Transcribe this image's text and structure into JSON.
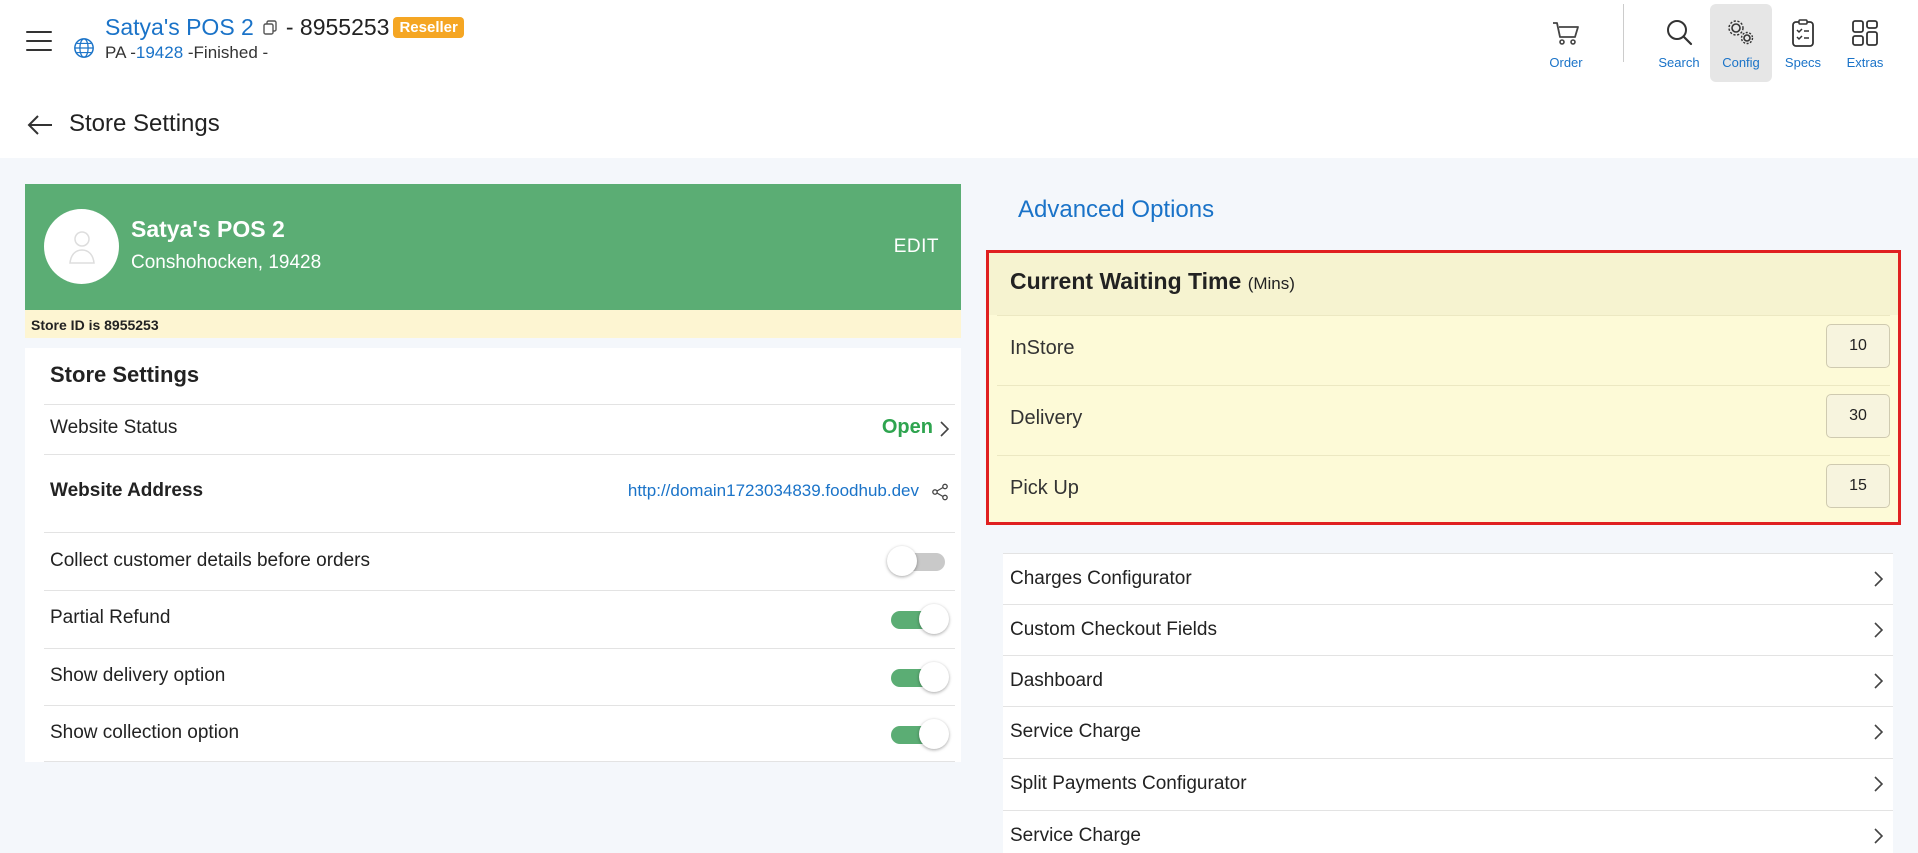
{
  "header": {
    "store_name": "Satya's POS 2",
    "store_id_text": "- 8955253",
    "badge": "Reseller",
    "line2_prefix": "PA -",
    "line2_zip": "19428",
    "line2_suffix": " -Finished -",
    "nav": [
      {
        "label": "Order",
        "icon": "cart-icon"
      },
      {
        "label": "Search",
        "icon": "search-icon"
      },
      {
        "label": "Config",
        "icon": "gears-icon"
      },
      {
        "label": "Specs",
        "icon": "clipboard-icon"
      },
      {
        "label": "Extras",
        "icon": "grid-icon"
      }
    ]
  },
  "subheader": {
    "title": "Store Settings"
  },
  "store_card": {
    "name": "Satya's POS 2",
    "address": "Conshohocken, 19428",
    "edit_label": "EDIT",
    "store_id_note": "Store ID is 8955253"
  },
  "settings": {
    "title": "Store Settings",
    "website_status_label": "Website Status",
    "website_status_value": "Open",
    "website_address_label": "Website Address",
    "website_address_value": "http://domain1723034839.foodhub.dev",
    "toggles": [
      {
        "label": "Collect customer details before orders",
        "on": false
      },
      {
        "label": "Partial Refund",
        "on": true
      },
      {
        "label": "Show delivery option",
        "on": true
      },
      {
        "label": "Show collection option",
        "on": true
      }
    ]
  },
  "advanced": {
    "title": "Advanced Options",
    "waiting_title": "Current Waiting Time",
    "waiting_unit": "(Mins)",
    "waiting_rows": [
      {
        "label": "InStore",
        "value": "10"
      },
      {
        "label": "Delivery",
        "value": "30"
      },
      {
        "label": "Pick Up",
        "value": "15"
      }
    ],
    "options": [
      "Charges Configurator",
      "Custom Checkout Fields",
      "Dashboard",
      "Service Charge",
      "Split Payments Configurator",
      "Service Charge"
    ]
  },
  "colors": {
    "accent": "#1a73c8",
    "card_green": "#5bad74",
    "open_green": "#2ea44f",
    "badge_orange": "#f5a623",
    "highlight_red": "#e02020"
  }
}
